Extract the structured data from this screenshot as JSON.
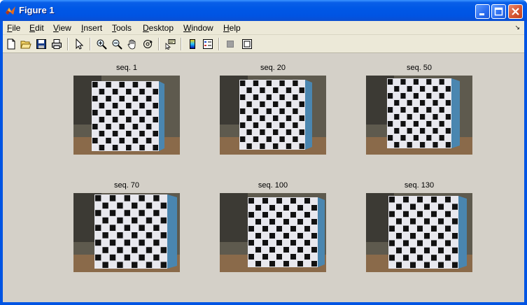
{
  "window": {
    "title": "Figure 1",
    "controls": [
      "minimize-icon",
      "maximize-icon",
      "close-icon"
    ]
  },
  "menubar": {
    "items": [
      {
        "hot": "F",
        "rest": "ile"
      },
      {
        "hot": "E",
        "rest": "dit"
      },
      {
        "hot": "V",
        "rest": "iew"
      },
      {
        "hot": "I",
        "rest": "nsert"
      },
      {
        "hot": "T",
        "rest": "ools"
      },
      {
        "hot": "D",
        "rest": "esktop"
      },
      {
        "hot": "W",
        "rest": "indow"
      },
      {
        "hot": "H",
        "rest": "elp"
      }
    ],
    "overflow": "↘"
  },
  "toolbar": {
    "icons": [
      "new-figure-icon",
      "open-file-icon",
      "save-icon",
      "print-icon",
      "edit-plot-arrow-icon",
      "zoom-in-icon",
      "zoom-out-icon",
      "pan-hand-icon",
      "rotate-3d-icon",
      "data-cursor-icon",
      "colorbar-icon",
      "legend-icon",
      "hide-plot-tools-icon",
      "show-plot-tools-icon"
    ]
  },
  "subplots": [
    {
      "title": "seq. 1"
    },
    {
      "title": "seq. 20"
    },
    {
      "title": "seq. 50"
    },
    {
      "title": "seq. 70"
    },
    {
      "title": "seq. 100"
    },
    {
      "title": "seq. 130"
    }
  ],
  "colors": {
    "titlebar": "#0054e3",
    "client": "#d4d0c8",
    "menubar": "#ece9d8",
    "checker_dark": "#111111",
    "checker_light": "#e8e8ee",
    "box_side": "#4a86b0",
    "table": "#8a6a4a"
  }
}
